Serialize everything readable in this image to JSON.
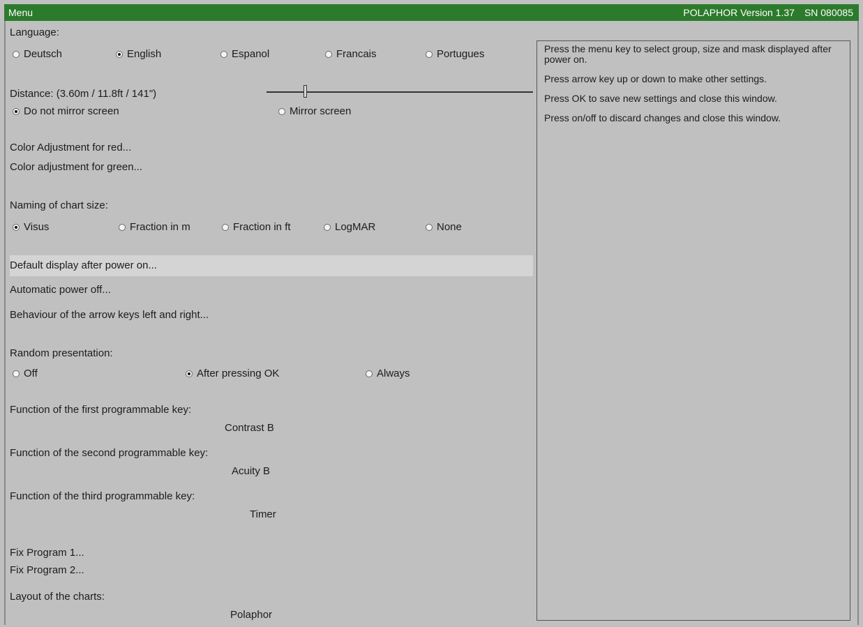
{
  "titlebar": {
    "left": "Menu",
    "product": "POLAPHOR Version 1.37",
    "serial": "SN 080085"
  },
  "language": {
    "label": "Language:",
    "options": [
      "Deutsch",
      "English",
      "Espanol",
      "Francais",
      "Portugues"
    ],
    "selected": 1
  },
  "distance": {
    "label": "Distance: (3.60m / 11.8ft / 141\")",
    "slider_fraction": 0.14
  },
  "mirror": {
    "options": [
      "Do not mirror screen",
      "Mirror screen"
    ],
    "selected": 0
  },
  "color": {
    "red": "Color Adjustment for red...",
    "green": "Color adjustment for green..."
  },
  "naming": {
    "label": "Naming of chart size:",
    "options": [
      "Visus",
      "Fraction in m",
      "Fraction in ft",
      "LogMAR",
      "None"
    ],
    "selected": 0
  },
  "items": {
    "default_display": "Default display after power on...",
    "auto_power": "Automatic power off...",
    "arrow_keys": "Behaviour of the arrow keys left and right..."
  },
  "random": {
    "label": "Random presentation:",
    "options": [
      "Off",
      "After pressing OK",
      "Always"
    ],
    "selected": 1
  },
  "keys": {
    "first_label": "Function of the first programmable key:",
    "first_value": "Contrast B",
    "second_label": "Function of the second programmable key:",
    "second_value": "Acuity B",
    "third_label": "Function of the third programmable key:",
    "third_value": "Timer"
  },
  "programs": {
    "p1": "Fix Program 1...",
    "p2": "Fix Program 2..."
  },
  "layout": {
    "label": "Layout of the charts:",
    "value": "Polaphor"
  },
  "help": {
    "p1": "Press the menu key to select group, size and mask displayed after power on.",
    "p2": "Press arrow key up or down to make other settings.",
    "p3": "Press OK to save new settings and close this window.",
    "p4": "Press on/off to discard changes and close this window."
  }
}
